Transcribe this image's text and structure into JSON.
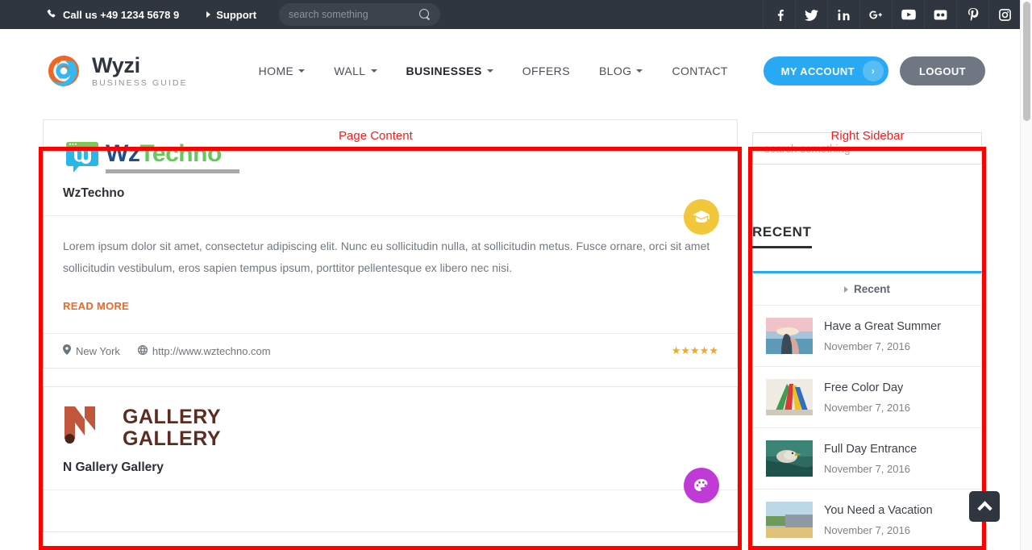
{
  "topbar": {
    "phone_icon": "phone-icon",
    "phone_label": "Call us +49 1234 5678 9",
    "support_label": "Support",
    "search_placeholder": "search something",
    "search_value": "",
    "search_icon": "search-icon",
    "socials": [
      {
        "name": "facebook",
        "glyph": "f"
      },
      {
        "name": "twitter",
        "glyph": "t"
      },
      {
        "name": "linkedin",
        "glyph": "in"
      },
      {
        "name": "google-plus",
        "glyph": "G+"
      },
      {
        "name": "youtube",
        "glyph": "yt"
      },
      {
        "name": "flickr",
        "glyph": "fl"
      },
      {
        "name": "pinterest",
        "glyph": "P"
      },
      {
        "name": "instagram",
        "glyph": "ig"
      }
    ],
    "bg_color": "#2f3640"
  },
  "header": {
    "logo_title": "Wyzi",
    "logo_subtitle": "BUSINESS GUIDE",
    "logo_icon": "wyzi-swirl-logo",
    "nav": [
      {
        "label": "HOME",
        "has_dropdown": true,
        "active": false
      },
      {
        "label": "WALL",
        "has_dropdown": true,
        "active": false
      },
      {
        "label": "BUSINESSES",
        "has_dropdown": true,
        "active": true
      },
      {
        "label": "OFFERS",
        "has_dropdown": false,
        "active": false
      },
      {
        "label": "BLOG",
        "has_dropdown": true,
        "active": false
      },
      {
        "label": "CONTACT",
        "has_dropdown": false,
        "active": false
      }
    ],
    "account_label": "MY ACCOUNT",
    "account_badge_icon": "chevron-right-icon",
    "account_color": "#29a9f3",
    "logout_label": "LOGOUT",
    "logout_color": "#6e7782"
  },
  "annotations": {
    "page_content": "Page Content",
    "right_sidebar": "Right Sidebar",
    "color": "#ff0000"
  },
  "listings": [
    {
      "logo_type": "wztechno",
      "logo_part_1": "Wz",
      "logo_part_2": "Techno",
      "name": "WzTechno",
      "description": "Lorem ipsum dolor sit amet, consectetur adipiscing elit. Nunc eu sollicitudin nulla, at sollicitudin metus. Fusce ornare, orci sit amet sollicitudin vestibulum, eros sapien tempus ipsum, porttitor pellentesque ex libero nec nisi.",
      "read_more": "READ MORE",
      "location_icon": "map-pin-icon",
      "location": "New York",
      "website_icon": "globe-icon",
      "website": "http://www.wztechno.com",
      "rating": 5,
      "star_icon": "star-icon",
      "badge_icon": "graduation-cap-icon",
      "badge_color": "#f3c73b"
    },
    {
      "logo_type": "gallery",
      "logo_line_1": "GALLERY",
      "logo_line_2": "GALLERY",
      "name": "N Gallery Gallery",
      "badge_icon": "palette-icon",
      "badge_color": "#c03ad8"
    }
  ],
  "sidebar": {
    "search_placeholder": "search something",
    "search_value": "",
    "heading": "RECENT",
    "tab_label": "Recent",
    "tab_caret_icon": "caret-right-icon",
    "accent_color": "#29a9f3",
    "posts": [
      {
        "title": "Have a Great Summer",
        "date": "November 7, 2016",
        "thumb": "beach-photo"
      },
      {
        "title": "Free Color Day",
        "date": "November 7, 2016",
        "thumb": "shopping-bags-photo"
      },
      {
        "title": "Full Day Entrance",
        "date": "November 7, 2016",
        "thumb": "pelican-photo"
      },
      {
        "title": "You Need a Vacation",
        "date": "November 7, 2016",
        "thumb": "landscape-photo"
      }
    ]
  },
  "scroll_top": {
    "icon": "chevron-up-icon"
  }
}
